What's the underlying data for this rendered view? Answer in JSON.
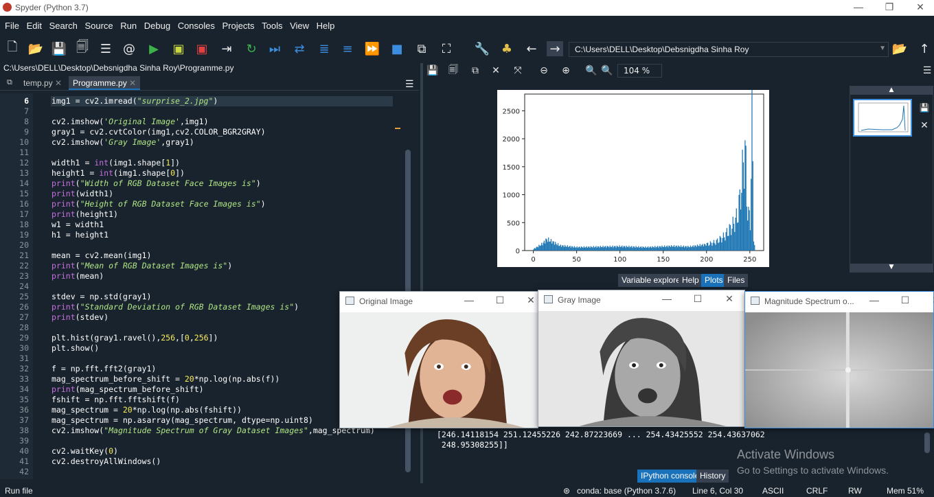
{
  "app": {
    "title": "Spyder (Python 3.7)"
  },
  "menu": [
    "File",
    "Edit",
    "Search",
    "Source",
    "Run",
    "Debug",
    "Consoles",
    "Projects",
    "Tools",
    "View",
    "Help"
  ],
  "toolbar": {
    "working_dir": "C:\\Users\\DELL\\Desktop\\Debsnigdha Sinha Roy"
  },
  "editor": {
    "path": "C:\\Users\\DELL\\Desktop\\Debsnigdha Sinha Roy\\Programme.py",
    "tabs": [
      {
        "label": "temp.py"
      },
      {
        "label": "Programme.py",
        "active": true
      }
    ],
    "line_numbers": [
      "6",
      "7",
      "8",
      "9",
      "10",
      "11",
      "12",
      "13",
      "14",
      "15",
      "16",
      "17",
      "18",
      "19",
      "20",
      "21",
      "22",
      "23",
      "24",
      "25",
      "26",
      "27",
      "28",
      "29",
      "30",
      "31",
      "32",
      "33",
      "34",
      "35",
      "36",
      "37",
      "38",
      "39",
      "40",
      "41",
      "42"
    ],
    "lines": [
      [
        [
          "img1 = cv2.imread(",
          ""
        ],
        [
          "\"surprise_2.jpg\"",
          "str"
        ],
        [
          ")",
          ""
        ]
      ],
      [],
      [
        [
          "cv2.imshow(",
          ""
        ],
        [
          "'Original Image'",
          "str"
        ],
        [
          ",img1)",
          ""
        ]
      ],
      [
        [
          "gray1 = cv2.cvtColor(img1,cv2.COLOR_BGR2GRAY)",
          ""
        ]
      ],
      [
        [
          "cv2.imshow(",
          ""
        ],
        [
          "'Gray Image'",
          "str"
        ],
        [
          ",gray1)",
          ""
        ]
      ],
      [],
      [
        [
          "width1 = ",
          ""
        ],
        [
          "int",
          "kw"
        ],
        [
          "(img1.shape[",
          ""
        ],
        [
          "1",
          "num"
        ],
        [
          "])",
          ""
        ]
      ],
      [
        [
          "height1 = ",
          ""
        ],
        [
          "int",
          "kw"
        ],
        [
          "(img1.shape[",
          ""
        ],
        [
          "0",
          "num"
        ],
        [
          "])",
          ""
        ]
      ],
      [
        [
          "print",
          "kw"
        ],
        [
          "(",
          ""
        ],
        [
          "\"Width of RGB Dataset Face Images is\"",
          "str"
        ],
        [
          ")",
          ""
        ]
      ],
      [
        [
          "print",
          "kw"
        ],
        [
          "(width1)",
          ""
        ]
      ],
      [
        [
          "print",
          "kw"
        ],
        [
          "(",
          ""
        ],
        [
          "\"Height of RGB Dataset Face Images is\"",
          "str"
        ],
        [
          ")",
          ""
        ]
      ],
      [
        [
          "print",
          "kw"
        ],
        [
          "(height1)",
          ""
        ]
      ],
      [
        [
          "w1 = width1",
          ""
        ]
      ],
      [
        [
          "h1 = height1",
          ""
        ]
      ],
      [],
      [
        [
          "mean = cv2.mean(img1)",
          ""
        ]
      ],
      [
        [
          "print",
          "kw"
        ],
        [
          "(",
          ""
        ],
        [
          "\"Mean of RGB Dataset Images is\"",
          "str"
        ],
        [
          ")",
          ""
        ]
      ],
      [
        [
          "print",
          "kw"
        ],
        [
          "(mean)",
          ""
        ]
      ],
      [],
      [
        [
          "stdev = np.std(gray1)",
          ""
        ]
      ],
      [
        [
          "print",
          "kw"
        ],
        [
          "(",
          ""
        ],
        [
          "\"Standard Deviation of RGB Dataset Images is\"",
          "str"
        ],
        [
          ")",
          ""
        ]
      ],
      [
        [
          "print",
          "kw"
        ],
        [
          "(stdev)",
          ""
        ]
      ],
      [],
      [
        [
          "plt.hist(gray1.ravel(),",
          ""
        ],
        [
          "256",
          "num"
        ],
        [
          ",[",
          ""
        ],
        [
          "0",
          "num"
        ],
        [
          ",",
          ""
        ],
        [
          "256",
          "num"
        ],
        [
          "])",
          ""
        ]
      ],
      [
        [
          "plt.show()",
          ""
        ]
      ],
      [],
      [
        [
          "f = np.fft.fft2(gray1)",
          ""
        ]
      ],
      [
        [
          "mag_spectrum_before_shift = ",
          ""
        ],
        [
          "20",
          "num"
        ],
        [
          "*np.log(np.abs(f))",
          ""
        ]
      ],
      [
        [
          "print",
          "kw"
        ],
        [
          "(mag_spectrum_before_shift)",
          ""
        ]
      ],
      [
        [
          "fshift = np.fft.fftshift(f)",
          ""
        ]
      ],
      [
        [
          "mag_spectrum = ",
          ""
        ],
        [
          "20",
          "num"
        ],
        [
          "*np.log(np.abs(fshift))",
          ""
        ]
      ],
      [
        [
          "mag_spectrum = np.asarray(mag_spectrum, dtype=np.uint8)",
          ""
        ]
      ],
      [
        [
          "cv2.imshow(",
          ""
        ],
        [
          "\"Magnitude Spectrum of Gray Dataset Images\"",
          "str"
        ],
        [
          ",mag_spectrum)",
          ""
        ]
      ],
      [],
      [
        [
          "cv2.waitKey(",
          ""
        ],
        [
          "0",
          "num"
        ],
        [
          ")",
          ""
        ]
      ],
      [
        [
          "cv2.destroyAllWindows()",
          ""
        ]
      ],
      []
    ]
  },
  "plots": {
    "zoom": "104 %"
  },
  "chart_data": {
    "type": "bar",
    "title": "",
    "xlabel": "",
    "ylabel": "",
    "xlim": [
      -10,
      266
    ],
    "ylim": [
      0,
      2800
    ],
    "xticks": [
      0,
      50,
      100,
      150,
      200,
      250
    ],
    "yticks": [
      0,
      500,
      1000,
      1500,
      2000,
      2500
    ],
    "bins_x": [
      0,
      10,
      15,
      20,
      30,
      50,
      80,
      100,
      130,
      160,
      180,
      200,
      210,
      220,
      225,
      230,
      235,
      238,
      240,
      242,
      244,
      246,
      248,
      250,
      252,
      254,
      255
    ],
    "bins_y": [
      30,
      120,
      200,
      170,
      90,
      60,
      70,
      75,
      60,
      80,
      70,
      110,
      150,
      250,
      350,
      450,
      600,
      900,
      1200,
      1500,
      1900,
      900,
      650,
      500,
      2650,
      250,
      100
    ]
  },
  "pane_tabs": [
    "Variable explorer",
    "Help",
    "Plots",
    "Files"
  ],
  "console": {
    "output_line1": "[246.14118154 251.12455226 242.87223669 ... 254.43425552 254.43637062",
    "output_line2": " 248.95308255]]",
    "tabs": [
      "IPython console",
      "History"
    ],
    "watermark_title": "Activate Windows",
    "watermark_sub": "Go to Settings to activate Windows."
  },
  "windows": [
    {
      "title": "Original Image"
    },
    {
      "title": "Gray Image"
    },
    {
      "title": "Magnitude Spectrum o..."
    }
  ],
  "status": {
    "left": "Run file",
    "env": "conda: base (Python 3.7.6)",
    "position": "Line 6, Col 30",
    "encoding": "ASCII",
    "eol": "CRLF",
    "mode": "RW",
    "mem": "Mem 51%"
  }
}
